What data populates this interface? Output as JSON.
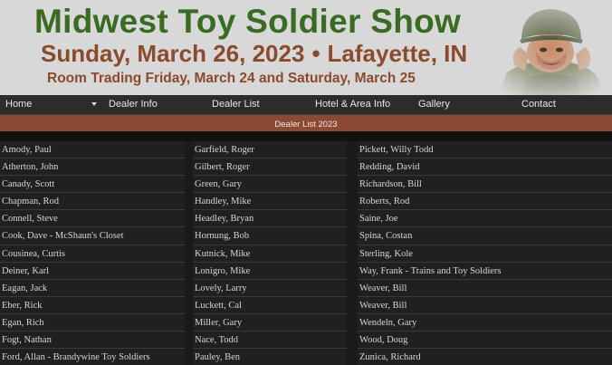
{
  "header": {
    "title": "Midwest Toy Soldier Show",
    "date": "Sunday, March 26, 2023",
    "bullet": "•",
    "location": "Lafayette, IN",
    "room_trading": "Room Trading Friday, March 24 and Saturday, March 25"
  },
  "nav": {
    "items": [
      {
        "label": "Home"
      },
      {
        "label": "Dealer Info"
      },
      {
        "label": "Dealer List"
      },
      {
        "label": "Hotel & Area Info"
      },
      {
        "label": "Gallery"
      },
      {
        "label": "Contact"
      }
    ]
  },
  "section": {
    "title": "Dealer List 2023"
  },
  "dealers": {
    "col1": [
      "Amody, Paul",
      "Atherton, John",
      "Canady, Scott",
      "Chapman, Rod",
      "Connell, Steve",
      "Cook, Dave - McShaun's Closet",
      "Cousinea, Curtis",
      "Deiner, Karl",
      "Eagan, Jack",
      "Eber, Rick",
      "Egan, Rich",
      "Fogt, Nathan",
      "Ford, Allan - Brandywine Toy Soldiers"
    ],
    "col2": [
      "Garfield, Roger",
      "Gilbert, Roger",
      "Green, Gary",
      "Handley, Mike",
      "Headley, Bryan",
      "Hornung, Bob",
      "Kutnick, Mike",
      "Lonigro, Mike",
      "Lovely, Larry",
      "Luckett, Cal",
      "Miller, Gary",
      "Nace, Todd",
      "Pauley, Ben"
    ],
    "col3": [
      "Pickett, Willy Todd",
      "Redding, David",
      "Richardson, Bill",
      "Roberts, Rod",
      "Saine, Joe",
      "Spina, Costan",
      "Sterling, Kole",
      "Way, Frank - Trains and Toy Soldiers",
      "Weaver, Bill",
      "Weaver, Bill",
      "Wendeln, Gary",
      "Wood, Doug",
      "Zunica, Richard"
    ]
  }
}
